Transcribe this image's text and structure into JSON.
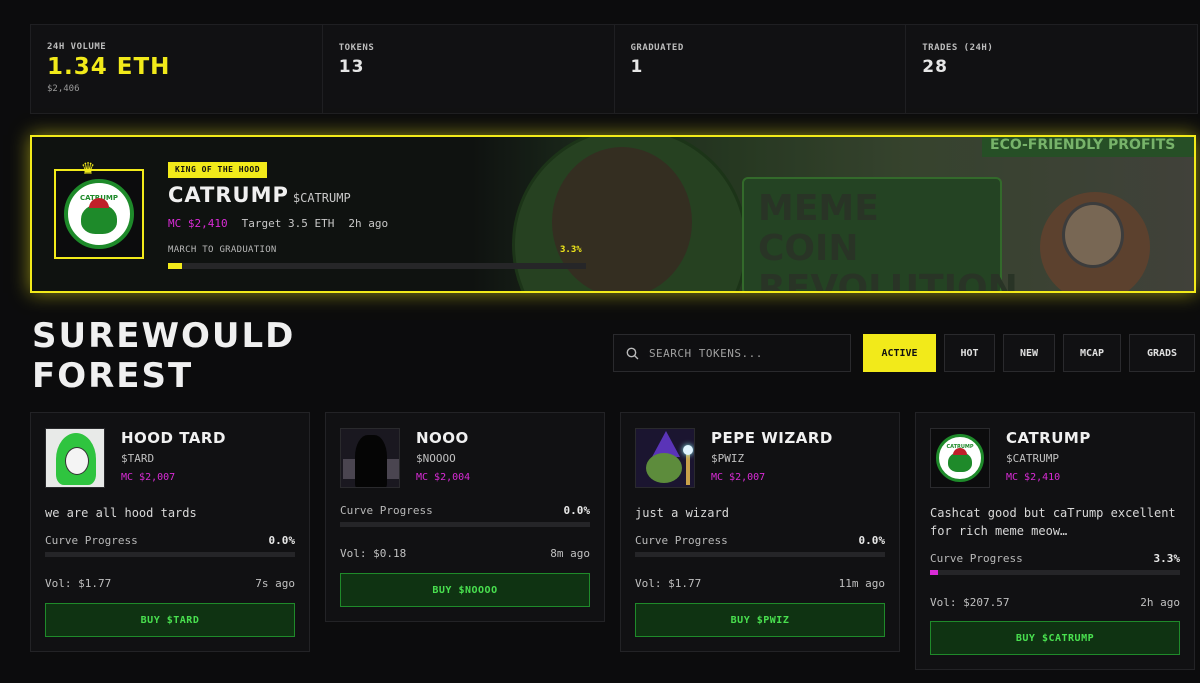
{
  "stats": [
    {
      "label": "24H VOLUME",
      "value": "1.34 ETH",
      "sub": "$2,406"
    },
    {
      "label": "TOKENS",
      "value": "13"
    },
    {
      "label": "GRADUATED",
      "value": "1"
    },
    {
      "label": "TRADES (24H)",
      "value": "28"
    }
  ],
  "king": {
    "tag": "KING OF THE HOOD",
    "name": "CATRUMP",
    "ticker": "$CATRUMP",
    "mc": "MC $2,410",
    "target": "Target 3.5 ETH",
    "age": "2h ago",
    "march_label": "MARCH TO GRADUATION",
    "march_pct": "3.3%",
    "progress": 3.3,
    "banner_top": "ECO-FRIENDLY PROFITS",
    "banner_text": "MEME COIN REVOLUTION",
    "logo_text": "CATRUMP"
  },
  "title_line1": "SUREWOULD",
  "title_line2": "FOREST",
  "search": {
    "placeholder": "SEARCH TOKENS..."
  },
  "filters": [
    "ACTIVE",
    "HOT",
    "NEW",
    "MCAP",
    "GRADS"
  ],
  "cards": [
    {
      "name": "HOOD TARD",
      "ticker": "$TARD",
      "mc": "MC $2,007",
      "desc": "we are all hood tards",
      "curve_label": "Curve Progress",
      "curve_pct": "0.0%",
      "progress": 0.0,
      "vol": "Vol: $1.77",
      "age": "7s ago",
      "buy": "BUY $TARD"
    },
    {
      "name": "NOOO",
      "ticker": "$NOOOO",
      "mc": "MC $2,004",
      "desc": "",
      "curve_label": "Curve Progress",
      "curve_pct": "0.0%",
      "progress": 0.0,
      "vol": "Vol: $0.18",
      "age": "8m ago",
      "buy": "BUY $NOOOO"
    },
    {
      "name": "PEPE WIZARD",
      "ticker": "$PWIZ",
      "mc": "MC $2,007",
      "desc": "just a wizard",
      "curve_label": "Curve Progress",
      "curve_pct": "0.0%",
      "progress": 0.0,
      "vol": "Vol: $1.77",
      "age": "11m ago",
      "buy": "BUY $PWIZ"
    },
    {
      "name": "CATRUMP",
      "ticker": "$CATRUMP",
      "mc": "MC $2,410",
      "desc": "Cashcat good but caTrump excellent for rich meme meow…",
      "curve_label": "Curve Progress",
      "curve_pct": "3.3%",
      "progress": 3.3,
      "vol": "Vol: $207.57",
      "age": "2h ago",
      "buy": "BUY $CATRUMP",
      "logo_text": "CATRUMP"
    }
  ],
  "colors": {
    "accent": "#f2ea1a",
    "magenta": "#d92bd6",
    "buy_green": "#49e04f"
  }
}
